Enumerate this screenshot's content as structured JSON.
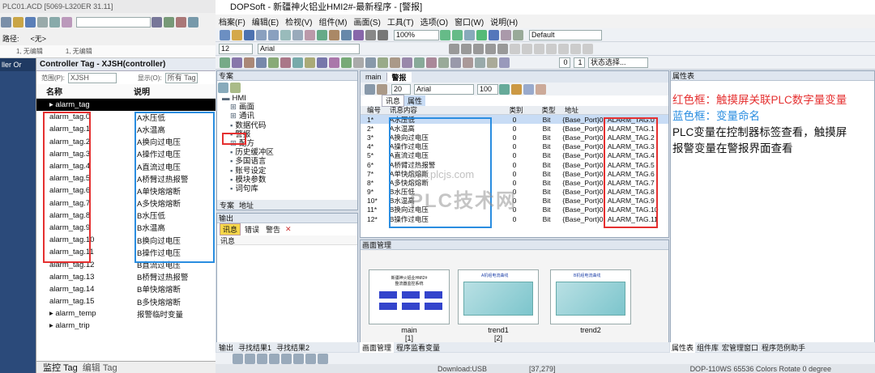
{
  "left_app": {
    "title": "PLC01.ACD [5069-L320ER 31.11]",
    "path_label": "路径:",
    "path_value": "<无>",
    "tb3_items": [
      "1, 无编辑",
      "1, 无编辑"
    ],
    "nav_strip_title": "ller Or",
    "panel": {
      "tab_title": "Controller Tag - XJSH(controller)",
      "scope_label": "范围(P):",
      "scope_value": "XJSH",
      "show_label": "显示(O):",
      "show_value": "所有 Tag",
      "col_name": "名称",
      "col_desc": "说明",
      "rows": [
        {
          "name": "▸ alarm_tag",
          "desc": ""
        },
        {
          "name": "alarm_tag.0",
          "desc": "A水压低"
        },
        {
          "name": "alarm_tag.1",
          "desc": "A水温高"
        },
        {
          "name": "alarm_tag.2",
          "desc": "A换向过电压"
        },
        {
          "name": "alarm_tag.3",
          "desc": "A操作过电压"
        },
        {
          "name": "alarm_tag.4",
          "desc": "A直流过电压"
        },
        {
          "name": "alarm_tag.5",
          "desc": "A桥臂过热报警"
        },
        {
          "name": "alarm_tag.6",
          "desc": "A单快熔熔断"
        },
        {
          "name": "alarm_tag.7",
          "desc": "A多快熔熔断"
        },
        {
          "name": "alarm_tag.8",
          "desc": "B水压低"
        },
        {
          "name": "alarm_tag.9",
          "desc": "B水温高"
        },
        {
          "name": "alarm_tag.10",
          "desc": "B换向过电压"
        },
        {
          "name": "alarm_tag.11",
          "desc": "B操作过电压"
        },
        {
          "name": "alarm_tag.12",
          "desc": "B直流过电压"
        },
        {
          "name": "alarm_tag.13",
          "desc": "B桥臂过热报警"
        },
        {
          "name": "alarm_tag.14",
          "desc": "B单快熔熔断"
        },
        {
          "name": "alarm_tag.15",
          "desc": "B多快熔熔断"
        },
        {
          "name": "▸ alarm_temp",
          "desc": "报警临时变量"
        },
        {
          "name": "▸ alarm_trip",
          "desc": ""
        }
      ],
      "bottom_tab_monitor": "监控 Tag",
      "bottom_tab_edit": "编辑 Tag"
    }
  },
  "dop": {
    "title": "DOPSoft - 新疆神火铝业HMI2#-最新程序 - [警报]",
    "menu": [
      "档案(F)",
      "编辑(E)",
      "检视(V)",
      "组件(M)",
      "画面(S)",
      "工具(T)",
      "选项(O)",
      "窗口(W)",
      "说明(H)"
    ],
    "zoom": "100%",
    "style_combo": "Default",
    "font_size": "12",
    "font_name": "Arial",
    "tb3_number": "0",
    "tb3_number2": "1",
    "state_combo": "状态选择...",
    "project_panel_title": "专案",
    "tree": [
      "HMI",
      "画面",
      "通讯",
      "数据代码",
      "警报",
      "配方",
      "历史缓冲区",
      "多国语言",
      "账号设定",
      "模块参数",
      "词句库"
    ],
    "project_tabs": [
      "专案",
      "地址"
    ],
    "output_title": "输出",
    "output_tabs": [
      "讯息",
      "错误",
      "警告"
    ],
    "output_col": "讯息",
    "output_bottom_tabs": [
      "输出",
      "寻找结果1",
      "寻找结果2"
    ],
    "doc_tabs": [
      "main",
      "警报"
    ],
    "doc_font_size": "20",
    "doc_font": "Arial",
    "doc_zoom": "100",
    "sub_tabs": [
      "讯息",
      "属性"
    ],
    "alarm_headers": [
      "编号",
      "讯息内容",
      "类别",
      "类型",
      "地址"
    ],
    "alarms": [
      {
        "no": "1*",
        "msg": "A水压低",
        "cat": "0",
        "type": "Bit",
        "port": "{Base_Port}0@",
        "addr": "ALARM_TAG.0"
      },
      {
        "no": "2*",
        "msg": "A水温高",
        "cat": "0",
        "type": "Bit",
        "port": "{Base_Port}0@",
        "addr": "ALARM_TAG.1"
      },
      {
        "no": "3*",
        "msg": "A换向过电压",
        "cat": "0",
        "type": "Bit",
        "port": "{Base_Port}0@",
        "addr": "ALARM_TAG.2"
      },
      {
        "no": "4*",
        "msg": "A操作过电压",
        "cat": "0",
        "type": "Bit",
        "port": "{Base_Port}0@",
        "addr": "ALARM_TAG.3"
      },
      {
        "no": "5*",
        "msg": "A直流过电压",
        "cat": "0",
        "type": "Bit",
        "port": "{Base_Port}0@",
        "addr": "ALARM_TAG.4"
      },
      {
        "no": "6*",
        "msg": "A桥臂过热报警",
        "cat": "0",
        "type": "Bit",
        "port": "{Base_Port}0@",
        "addr": "ALARM_TAG.5"
      },
      {
        "no": "7*",
        "msg": "A单快熔熔断",
        "cat": "0",
        "type": "Bit",
        "port": "{Base_Port}0@",
        "addr": "ALARM_TAG.6"
      },
      {
        "no": "8*",
        "msg": "A多快熔熔断",
        "cat": "0",
        "type": "Bit",
        "port": "{Base_Port}0@",
        "addr": "ALARM_TAG.7"
      },
      {
        "no": "9*",
        "msg": "B水压低",
        "cat": "0",
        "type": "Bit",
        "port": "{Base_Port}0@",
        "addr": "ALARM_TAG.8"
      },
      {
        "no": "10*",
        "msg": "B水温高",
        "cat": "0",
        "type": "Bit",
        "port": "{Base_Port}0@",
        "addr": "ALARM_TAG.9"
      },
      {
        "no": "11*",
        "msg": "B换向过电压",
        "cat": "0",
        "type": "Bit",
        "port": "{Base_Port}0@",
        "addr": "ALARM_TAG.10"
      },
      {
        "no": "12*",
        "msg": "B操作过电压",
        "cat": "0",
        "type": "Bit",
        "port": "{Base_Port}0@",
        "addr": "ALARM_TAG.11"
      }
    ],
    "screens_title": "画面管理",
    "screens": [
      {
        "name": "main",
        "index": "[1]",
        "heading": "新疆神火铝业HMI2#",
        "sub": "整流器监控系统"
      },
      {
        "name": "trend1",
        "index": "[2]",
        "heading": "A机组电流曲线"
      },
      {
        "name": "trend2",
        "index": "",
        "heading": "B机组电流曲线"
      }
    ],
    "screens_bottom_tabs": [
      "画面管理",
      "程序监看变量"
    ],
    "props_title": "属性表",
    "props_bottom_tabs": [
      "属性表",
      "组件库",
      "宏管理窗口",
      "程序范例助手"
    ],
    "status": [
      "Download:USB",
      "[37,279]",
      "DOP-110WS 65536 Colors Rotate 0 degree"
    ]
  },
  "annotations": {
    "red_line": "红色框：触摸屏关联PLC数字量变量",
    "blue_line": "蓝色框：变量命名",
    "black_line_1": "PLC变量在控制器标签查看，触摸屏",
    "black_line_2": "报警变量在警报界面查看",
    "red_color": "#e53030",
    "blue_color": "#2a8de0"
  },
  "watermark": {
    "url": "www.plcjs.com",
    "brand": "PLC技术网"
  }
}
